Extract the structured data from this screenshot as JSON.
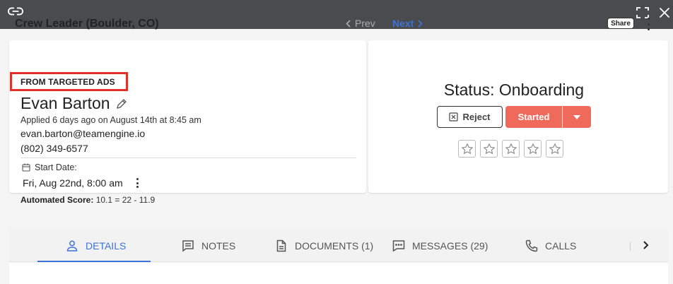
{
  "window": {
    "link_icon": "link-icon",
    "fullscreen_icon": "fullscreen-icon",
    "close_icon": "close-icon"
  },
  "header": {
    "title": "Crew Leader (Boulder, CO)",
    "prev_label": "Prev",
    "next_label": "Next",
    "share_label": "Share"
  },
  "candidate": {
    "source_badge": "FROM TARGETED ADS",
    "name": "Evan Barton",
    "applied": "Applied 6 days ago on August 14th at 8:45 am",
    "email": "evan.barton@teamengine.io",
    "phone": "(802) 349-6577",
    "start_date_label": "Start Date:",
    "start_date_value": "Fri, Aug 22nd, 8:00 am",
    "score_label": "Automated Score:",
    "score_value": "10.1 = 22 - 11.9"
  },
  "status": {
    "title": "Status: Onboarding",
    "reject_label": "Reject",
    "started_label": "Started",
    "rating": 0,
    "rating_max": 5
  },
  "tabs": [
    {
      "label": "DETAILS",
      "icon": "person-icon",
      "active": true
    },
    {
      "label": "NOTES",
      "icon": "notes-icon",
      "active": false
    },
    {
      "label": "DOCUMENTS (1)",
      "icon": "document-icon",
      "active": false
    },
    {
      "label": "MESSAGES (29)",
      "icon": "message-icon",
      "active": false
    },
    {
      "label": "CALLS",
      "icon": "phone-icon",
      "active": false
    }
  ],
  "colors": {
    "topbar": "#4a4b4f",
    "accent": "#3b73d8",
    "started": "#ef6a5b",
    "badge_border": "#e0302a"
  }
}
